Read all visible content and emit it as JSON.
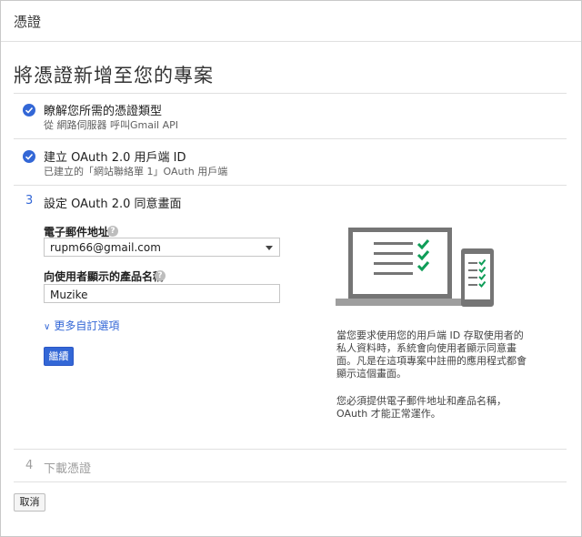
{
  "header": {
    "title": "憑證"
  },
  "page": {
    "title": "將憑證新增至您的專案"
  },
  "steps": [
    {
      "title": "瞭解您所需的憑證類型",
      "subtitle": "從 網路伺服器 呼叫Gmail API",
      "status": "done"
    },
    {
      "title": "建立 OAuth 2.0 用戶端 ID",
      "subtitle": "已建立的「網站聯絡單 1」OAuth 用戶端",
      "status": "done"
    },
    {
      "number": "3",
      "title": "設定 OAuth 2.0 同意畫面",
      "status": "active"
    },
    {
      "number": "4",
      "title": "下載憑證",
      "status": "pending"
    }
  ],
  "form": {
    "email_label": "電子郵件地址",
    "email_value": "rupm66@gmail.com",
    "product_label": "向使用者顯示的產品名稱",
    "product_value": "Muzike",
    "more_options": "更多自訂選項",
    "continue_label": "繼續"
  },
  "info": {
    "paragraph1": "當您要求使用您的用戶端 ID 存取使用者的私人資料時，系統會向使用者顯示同意畫面。凡是在這項專案中註冊的應用程式都會顯示這個畫面。",
    "paragraph2": "您必須提供電子郵件地址和產品名稱，OAuth 才能正常運作。"
  },
  "footer": {
    "cancel_label": "取消"
  },
  "colors": {
    "accent": "#3367d6",
    "check_green": "#0f9d58",
    "device_gray": "#757575"
  }
}
